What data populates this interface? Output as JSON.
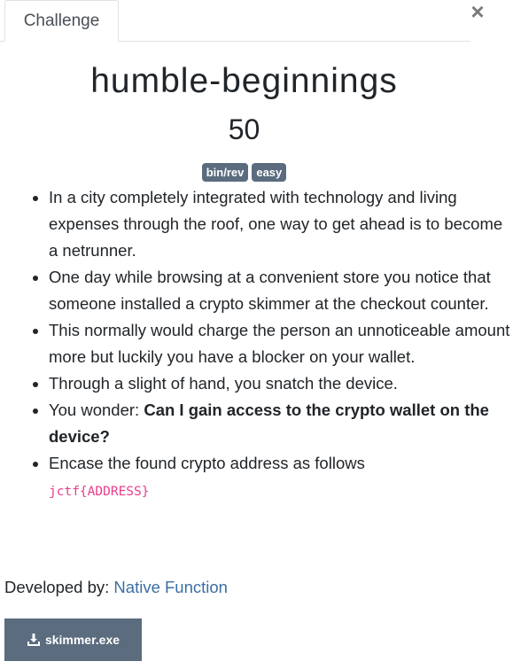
{
  "tab": {
    "label": "Challenge"
  },
  "close": {
    "symbol": "×"
  },
  "challenge": {
    "name": "humble-beginnings",
    "points": "50",
    "tags": [
      "bin/rev",
      "easy"
    ],
    "description": [
      {
        "text": "In a city completely integrated with technology and living expenses through the roof, one way to get ahead is to become a netrunner."
      },
      {
        "text": "One day while browsing at a convenient store you notice that someone installed a crypto skimmer at the checkout counter."
      },
      {
        "text": "This normally would charge the person an unnoticeable amount more but luckily you have a blocker on your wallet."
      },
      {
        "text": "Through a slight of hand, you snatch the device."
      },
      {
        "prefix": "You wonder: ",
        "bold": "Can I gain access to the crypto wallet on the device?"
      },
      {
        "text": "Encase the found crypto address as follows",
        "code": "jctf{ADDRESS}"
      }
    ]
  },
  "developer": {
    "label": "Developed by:",
    "name": "Native Function"
  },
  "file": {
    "label": "skimmer.exe",
    "icon": "download-icon"
  },
  "colors": {
    "tag_bg": "#5b6c7f",
    "link": "#3b6ea5",
    "code": "#e83e8c",
    "button_bg": "#5b6c7f"
  }
}
